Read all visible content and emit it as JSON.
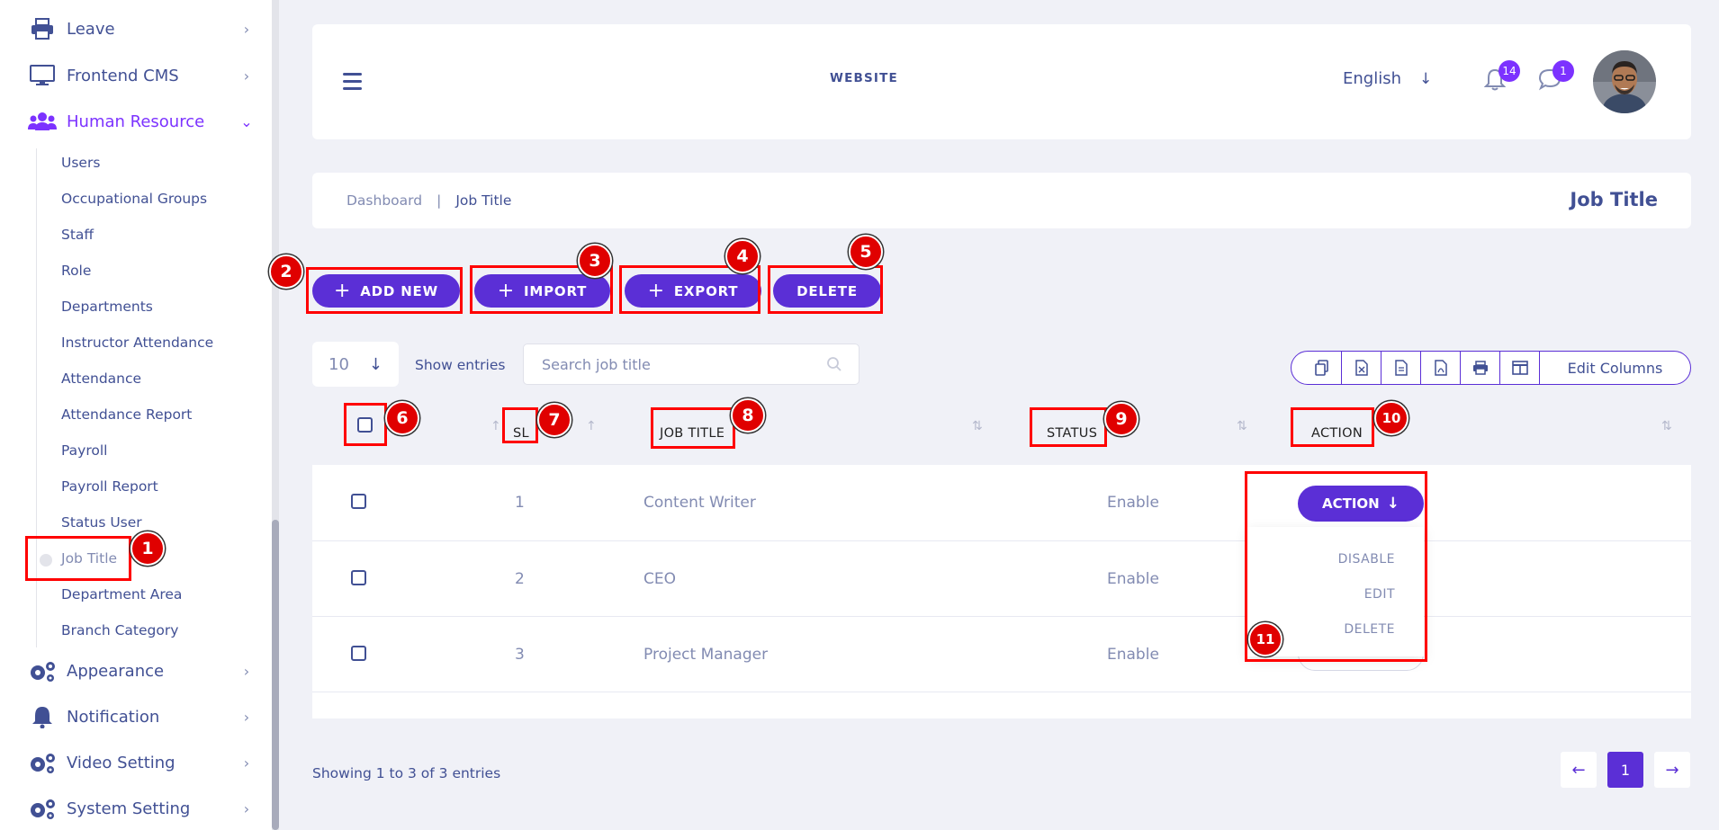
{
  "sidebar": {
    "menu": [
      {
        "label": "Leave",
        "icon": "printer-icon"
      },
      {
        "label": "Frontend CMS",
        "icon": "monitor-icon"
      },
      {
        "label": "Human Resource",
        "icon": "users-icon"
      },
      {
        "label": "Appearance",
        "icon": "gears-icon"
      },
      {
        "label": "Notification",
        "icon": "bell-icon"
      },
      {
        "label": "Video Setting",
        "icon": "gears-icon"
      },
      {
        "label": "System Setting",
        "icon": "gears-icon"
      }
    ],
    "sub_items": [
      "Users",
      "Occupational Groups",
      "Staff",
      "Role",
      "Departments",
      "Instructor Attendance",
      "Attendance",
      "Attendance Report",
      "Payroll",
      "Payroll Report",
      "Status User",
      "Job Title",
      "Department Area",
      "Branch Category"
    ]
  },
  "header": {
    "website_label": "WEBSITE",
    "language": "English",
    "notification_count": "14",
    "message_count": "1"
  },
  "breadcrumb": {
    "dashboard": "Dashboard",
    "separator": "|",
    "current": "Job Title",
    "page_title": "Job Title"
  },
  "actions": {
    "add_new": "ADD NEW",
    "import": "IMPORT",
    "export": "EXPORT",
    "delete": "DELETE"
  },
  "controls": {
    "per_page": "10",
    "show_entries": "Show entries",
    "search_placeholder": "Search job title",
    "edit_columns": "Edit Columns"
  },
  "table": {
    "headers": {
      "sl": "SL",
      "job_title": "JOB TITLE",
      "status": "STATUS",
      "action": "ACTION"
    },
    "rows": [
      {
        "sl": "1",
        "job_title": "Content Writer",
        "status": "Enable"
      },
      {
        "sl": "2",
        "job_title": "CEO",
        "status": "Enable"
      },
      {
        "sl": "3",
        "job_title": "Project Manager",
        "status": "Enable"
      }
    ],
    "action_button": "ACTION",
    "dropdown": [
      "DISABLE",
      "EDIT",
      "DELETE"
    ]
  },
  "footer": {
    "showing": "Showing 1 to 3 of 3 entries",
    "current_page": "1"
  },
  "markers": [
    "1",
    "2",
    "3",
    "4",
    "5",
    "6",
    "7",
    "8",
    "9",
    "10",
    "11"
  ],
  "colors": {
    "primary": "#5b2fd6",
    "text": "#415094",
    "muted": "#828bb2",
    "annotation": "#ff0000"
  }
}
